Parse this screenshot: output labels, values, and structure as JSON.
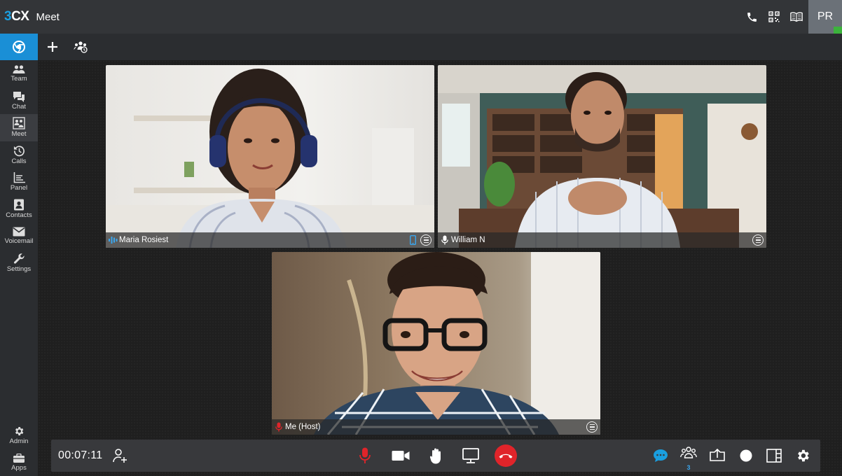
{
  "header": {
    "logo_number": "3",
    "logo_letters": "CX",
    "app_title": "Meet",
    "user_initials": "PR"
  },
  "sidebar": {
    "items": [
      {
        "label": "Team",
        "icon": "team-icon"
      },
      {
        "label": "Chat",
        "icon": "chat-icon"
      },
      {
        "label": "Meet",
        "icon": "meet-icon"
      },
      {
        "label": "Calls",
        "icon": "calls-icon"
      },
      {
        "label": "Panel",
        "icon": "panel-icon"
      },
      {
        "label": "Contacts",
        "icon": "contacts-icon"
      },
      {
        "label": "Voicemail",
        "icon": "voicemail-icon"
      },
      {
        "label": "Settings",
        "icon": "settings-icon"
      }
    ],
    "bottom_items": [
      {
        "label": "Admin",
        "icon": "admin-icon"
      },
      {
        "label": "Apps",
        "icon": "apps-icon"
      }
    ]
  },
  "participants": [
    {
      "name": "Maria Rosiest",
      "status": "speaking"
    },
    {
      "name": "William N",
      "status": "mic-on"
    },
    {
      "name": "Me (Host)",
      "status": "muted"
    }
  ],
  "call": {
    "elapsed": "00:07:11",
    "participant_count": "3"
  },
  "colors": {
    "accent": "#1a8fd6",
    "hangup": "#e0242a",
    "mute": "#e0242a",
    "presence": "#3cb33c"
  }
}
